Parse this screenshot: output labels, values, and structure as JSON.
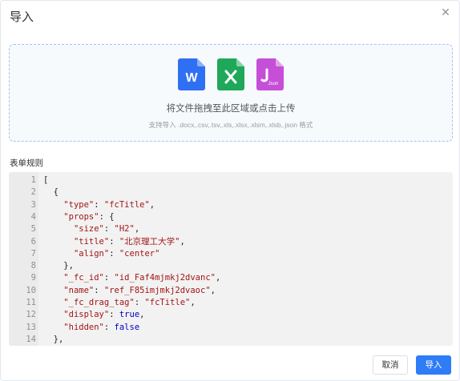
{
  "dialog": {
    "title": "导入",
    "close_icon": "close-icon"
  },
  "upload": {
    "icons": [
      {
        "name": "word-file-icon",
        "letter": "W",
        "color": "#2f6ff3"
      },
      {
        "name": "excel-file-icon",
        "letter": "✕",
        "color": "#1fa85a"
      },
      {
        "name": "json-file-icon",
        "letter": "Json",
        "color": "#c64fd7"
      }
    ],
    "text": "将文件拖拽至此区域或点击上传",
    "tip": "支持导入 .docx,.csv,.tsv,.xls,.xlsx,.xlsm,.xlsb,.json 格式"
  },
  "rules": {
    "label": "表单规则",
    "lines": [
      {
        "n": "1",
        "parts": [
          [
            "p",
            "["
          ]
        ]
      },
      {
        "n": "2",
        "parts": [
          [
            "p",
            "  {"
          ]
        ]
      },
      {
        "n": "3",
        "parts": [
          [
            "p",
            "    "
          ],
          [
            "k",
            "\"type\""
          ],
          [
            "p",
            ": "
          ],
          [
            "s",
            "\"fcTitle\""
          ],
          [
            "p",
            ","
          ]
        ]
      },
      {
        "n": "4",
        "parts": [
          [
            "p",
            "    "
          ],
          [
            "k",
            "\"props\""
          ],
          [
            "p",
            ": {"
          ]
        ]
      },
      {
        "n": "5",
        "parts": [
          [
            "p",
            "      "
          ],
          [
            "k",
            "\"size\""
          ],
          [
            "p",
            ": "
          ],
          [
            "s",
            "\"H2\""
          ],
          [
            "p",
            ","
          ]
        ]
      },
      {
        "n": "6",
        "parts": [
          [
            "p",
            "      "
          ],
          [
            "k",
            "\"title\""
          ],
          [
            "p",
            ": "
          ],
          [
            "s",
            "\"北京理工大学\""
          ],
          [
            "p",
            ","
          ]
        ]
      },
      {
        "n": "7",
        "parts": [
          [
            "p",
            "      "
          ],
          [
            "k",
            "\"align\""
          ],
          [
            "p",
            ": "
          ],
          [
            "s",
            "\"center\""
          ]
        ]
      },
      {
        "n": "8",
        "parts": [
          [
            "p",
            "    },"
          ]
        ]
      },
      {
        "n": "9",
        "parts": [
          [
            "p",
            "    "
          ],
          [
            "k",
            "\"_fc_id\""
          ],
          [
            "p",
            ": "
          ],
          [
            "s",
            "\"id_Faf4mjmkj2dvanc\""
          ],
          [
            "p",
            ","
          ]
        ]
      },
      {
        "n": "10",
        "parts": [
          [
            "p",
            "    "
          ],
          [
            "k",
            "\"name\""
          ],
          [
            "p",
            ": "
          ],
          [
            "s",
            "\"ref_F85imjmkj2dvaoc\""
          ],
          [
            "p",
            ","
          ]
        ]
      },
      {
        "n": "11",
        "parts": [
          [
            "p",
            "    "
          ],
          [
            "k",
            "\"_fc_drag_tag\""
          ],
          [
            "p",
            ": "
          ],
          [
            "s",
            "\"fcTitle\""
          ],
          [
            "p",
            ","
          ]
        ]
      },
      {
        "n": "12",
        "parts": [
          [
            "p",
            "    "
          ],
          [
            "k",
            "\"display\""
          ],
          [
            "p",
            ": "
          ],
          [
            "b",
            "true"
          ],
          [
            "p",
            ","
          ]
        ]
      },
      {
        "n": "13",
        "parts": [
          [
            "p",
            "    "
          ],
          [
            "k",
            "\"hidden\""
          ],
          [
            "p",
            ": "
          ],
          [
            "b",
            "false"
          ]
        ]
      },
      {
        "n": "14",
        "parts": [
          [
            "p",
            "  },"
          ]
        ]
      }
    ]
  },
  "footer": {
    "cancel_label": "取消",
    "ok_label": "导入"
  }
}
